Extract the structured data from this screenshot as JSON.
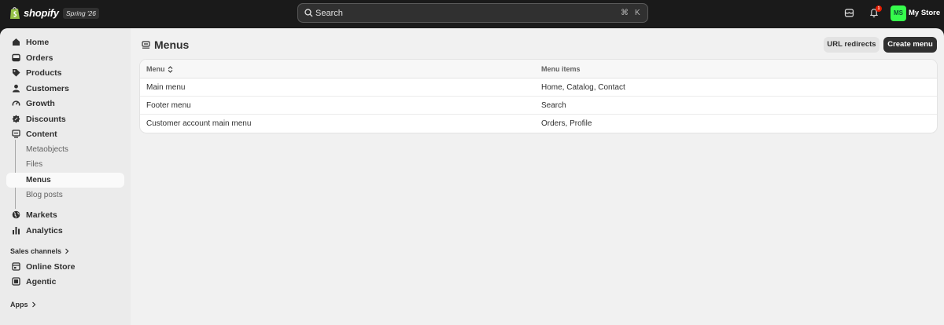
{
  "topbar": {
    "logo_text": "shopify",
    "version_badge": "Spring '26",
    "search_placeholder": "Search",
    "shortcut_cmd": "⌘",
    "shortcut_key": "K",
    "notification_count": "1",
    "avatar_initials": "MS",
    "store_name": "My Store"
  },
  "sidebar": {
    "items": [
      {
        "label": "Home",
        "icon": "home-icon"
      },
      {
        "label": "Orders",
        "icon": "orders-icon"
      },
      {
        "label": "Products",
        "icon": "tag-icon"
      },
      {
        "label": "Customers",
        "icon": "person-icon"
      },
      {
        "label": "Growth",
        "icon": "gauge-icon"
      },
      {
        "label": "Discounts",
        "icon": "discount-icon"
      },
      {
        "label": "Content",
        "icon": "content-icon"
      }
    ],
    "content_sub": [
      {
        "label": "Metaobjects"
      },
      {
        "label": "Files"
      },
      {
        "label": "Menus",
        "active": true
      },
      {
        "label": "Blog posts"
      }
    ],
    "items2": [
      {
        "label": "Markets",
        "icon": "globe-icon"
      },
      {
        "label": "Analytics",
        "icon": "chart-icon"
      }
    ],
    "sales_channels_label": "Sales channels",
    "channels": [
      {
        "label": "Online Store",
        "icon": "store-icon"
      },
      {
        "label": "Agentic",
        "icon": "agentic-icon"
      }
    ],
    "apps_label": "Apps"
  },
  "main": {
    "title": "Menus",
    "url_redirects_label": "URL redirects",
    "create_menu_label": "Create menu",
    "table": {
      "headers": [
        "Menu",
        "Menu items"
      ],
      "rows": [
        [
          "Main menu",
          "Home, Catalog, Contact"
        ],
        [
          "Footer menu",
          "Search"
        ],
        [
          "Customer account main menu",
          "Orders, Profile"
        ]
      ]
    }
  },
  "colors": {
    "topbar": "#1a1a1a",
    "avatar": "#36fb4c",
    "primary_button": "#303030",
    "notification": "#e51c00"
  }
}
